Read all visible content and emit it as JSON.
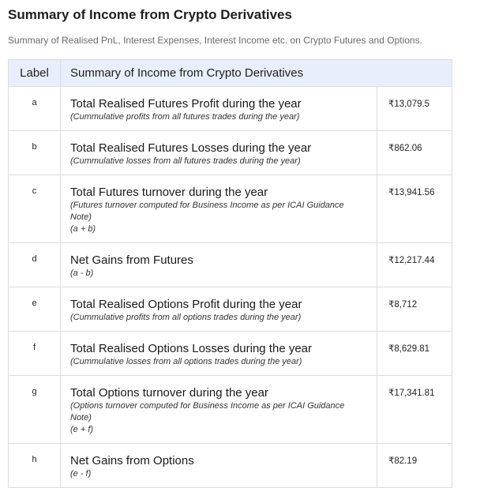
{
  "page": {
    "title": "Summary of Income from Crypto Derivatives",
    "subtitle": "Summary of Realised PnL, Interest Expenses, Interest Income etc. on Crypto Futures and Options."
  },
  "table": {
    "headers": {
      "label": "Label",
      "description": "Summary of Income from Crypto Derivatives"
    },
    "rows": [
      {
        "label": "a",
        "title": "Total Realised Futures Profit during the year",
        "note": "(Cummulative profits from all futures trades during the year)",
        "formula": "",
        "amount": "₹13,079.5"
      },
      {
        "label": "b",
        "title": "Total Realised Futures Losses during the year",
        "note": "(Cummulative losses from all futures trades during the year)",
        "formula": "",
        "amount": "₹862.06"
      },
      {
        "label": "c",
        "title": "Total Futures turnover during the year",
        "note": "(Futures turnover computed for Business Income as per ICAI Guidance Note)",
        "formula": "(a + b)",
        "amount": "₹13,941.56"
      },
      {
        "label": "d",
        "title": "Net Gains from Futures",
        "note": "",
        "formula": "(a - b)",
        "amount": "₹12,217.44"
      },
      {
        "label": "e",
        "title": "Total Realised Options Profit during the year",
        "note": "(Cummulative profits from all options trades during the year)",
        "formula": "",
        "amount": "₹8,712"
      },
      {
        "label": "f",
        "title": "Total Realised Options Losses during the year",
        "note": "(Cummulative losses from all options trades during the year)",
        "formula": "",
        "amount": "₹8,629.81"
      },
      {
        "label": "g",
        "title": "Total Options turnover during the year",
        "note": "(Options turnover computed for Business Income as per ICAI Guidance Note)",
        "formula": "(e + f)",
        "amount": "₹17,341.81"
      },
      {
        "label": "h",
        "title": "Net Gains from Options",
        "note": "",
        "formula": "(e - f)",
        "amount": "₹82.19"
      }
    ]
  }
}
